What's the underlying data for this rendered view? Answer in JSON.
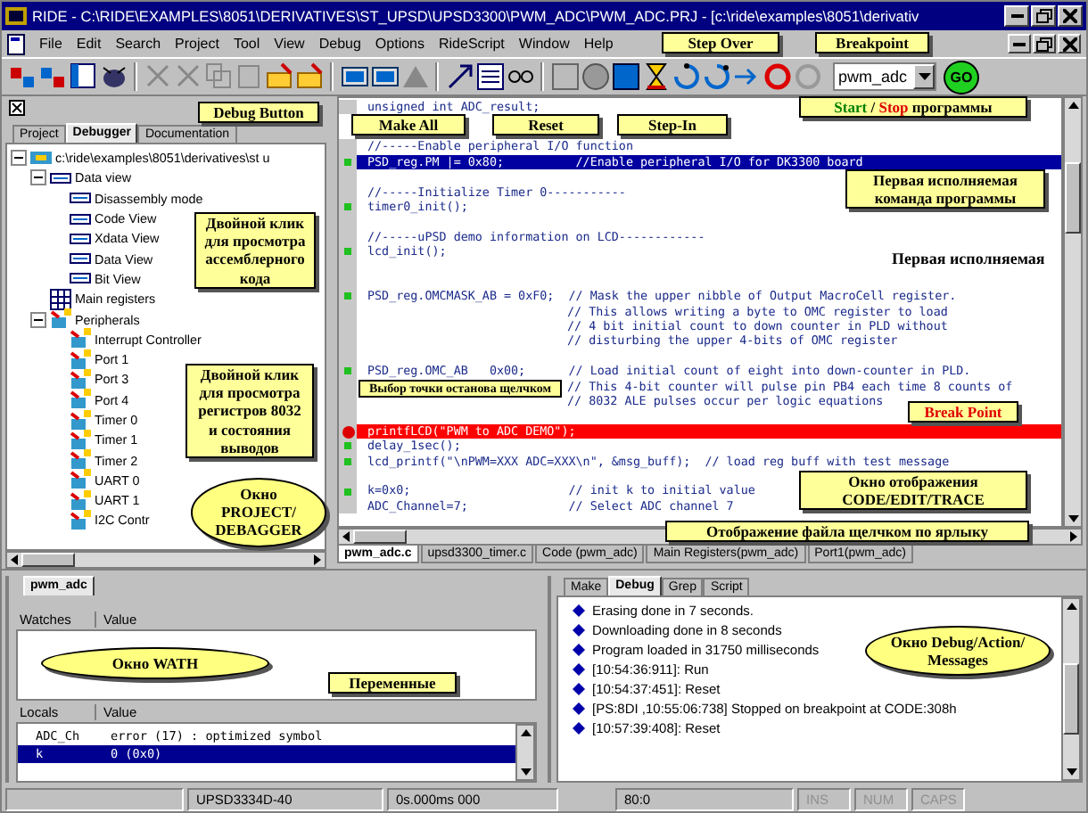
{
  "window": {
    "title": "RIDE - C:\\RIDE\\EXAMPLES\\8051\\DERIVATIVES\\ST_UPSD\\UPSD3300\\PWM_ADC\\PWM_ADC.PRJ - [c:\\ride\\examples\\8051\\derivativ"
  },
  "menu": [
    "File",
    "Edit",
    "Search",
    "Project",
    "Tool",
    "View",
    "Debug",
    "Options",
    "RideScript",
    "Window",
    "Help"
  ],
  "toolbar": {
    "target": "pwm_adc",
    "go_button": "GO"
  },
  "left_panel": {
    "tabs": [
      {
        "label": "Project",
        "selected": false
      },
      {
        "label": "Debugger",
        "selected": true
      },
      {
        "label": "Documentation",
        "selected": false
      }
    ],
    "tree": [
      {
        "label": "c:\\ride\\examples\\8051\\derivatives\\st u",
        "kind": "project",
        "expanded": true,
        "children": [
          {
            "label": "Data view",
            "kind": "view",
            "expanded": true,
            "children": [
              {
                "label": "Disassembly mode",
                "kind": "view"
              },
              {
                "label": "Code View",
                "kind": "view"
              },
              {
                "label": "Xdata View",
                "kind": "view"
              },
              {
                "label": "Data View",
                "kind": "view"
              },
              {
                "label": "Bit View",
                "kind": "view"
              }
            ]
          },
          {
            "label": "Main registers",
            "kind": "registers"
          },
          {
            "label": "Peripherals",
            "kind": "peripheral",
            "expanded": true,
            "children": [
              {
                "label": "Interrupt Controller",
                "kind": "peripheral"
              },
              {
                "label": "Port 1",
                "kind": "peripheral"
              },
              {
                "label": "Port 3",
                "kind": "peripheral"
              },
              {
                "label": "Port 4",
                "kind": "peripheral"
              },
              {
                "label": "Timer 0",
                "kind": "peripheral"
              },
              {
                "label": "Timer 1",
                "kind": "peripheral"
              },
              {
                "label": "Timer 2",
                "kind": "peripheral"
              },
              {
                "label": "UART 0",
                "kind": "peripheral"
              },
              {
                "label": "UART 1",
                "kind": "peripheral"
              },
              {
                "label": "I2C Contr",
                "kind": "peripheral"
              }
            ]
          }
        ]
      }
    ]
  },
  "editor": {
    "lines": [
      {
        "text": "unsigned int ADC_result;",
        "kind": "code",
        "marked": false
      },
      {
        "text": "//-----Enable peripheral I/O function",
        "kind": "code",
        "marked": false
      },
      {
        "text": "PSD_reg.PM |= 0x80;          //Enable peripheral I/O for DK3300 board",
        "kind": "current",
        "marked": true
      },
      {
        "kind": "code",
        "marked": false
      },
      {
        "text": "//-----Initialize Timer 0-----------",
        "kind": "code",
        "marked": false
      },
      {
        "text": "timer0_init();",
        "kind": "code",
        "marked": true
      },
      {
        "kind": "code",
        "marked": false
      },
      {
        "text": "//-----uPSD demo information on LCD------------",
        "kind": "code",
        "marked": false
      },
      {
        "text": "lcd_init();",
        "kind": "code",
        "marked": true
      },
      {
        "kind": "code",
        "marked": false
      },
      {
        "kind": "code",
        "marked": false
      },
      {
        "text": "PSD_reg.OMCMASK_AB = 0xF0;  // Mask the upper nibble of Output MacroCell register.",
        "kind": "code",
        "marked": true
      },
      {
        "text": "// This allows writing a byte to OMC register to load",
        "kind": "comment",
        "marked": false
      },
      {
        "text": "// 4 bit initial count to down counter in PLD without",
        "kind": "comment",
        "marked": false
      },
      {
        "text": "// disturbing the upper 4-bits of OMC register",
        "kind": "comment",
        "marked": false
      },
      {
        "kind": "code",
        "marked": false
      },
      {
        "text": "PSD_reg.OMC_AB   0x00;      // Load initial count of eight into down-counter in PLD.",
        "kind": "code",
        "marked": true
      },
      {
        "text": "// This 4-bit counter will pulse pin PB4 each time 8 counts of",
        "kind": "comment",
        "marked": false
      },
      {
        "text": "// 8032 ALE pulses occur per logic equations",
        "kind": "comment",
        "marked": false
      },
      {
        "kind": "code",
        "marked": false
      },
      {
        "text": "printfLCD(\"PWM to ADC DEMO\");",
        "kind": "breakpoint",
        "marked": false
      },
      {
        "text": "delay_1sec();",
        "kind": "code",
        "marked": true
      },
      {
        "text": "lcd_printf(\"\\nPWM=XXX ADC=XXX\\n\", &msg_buff);  // load reg buff with test message",
        "kind": "code",
        "marked": true
      },
      {
        "kind": "code",
        "marked": false
      },
      {
        "text": "k=0x0;                      // init k to initial value",
        "kind": "code",
        "marked": true
      },
      {
        "text": "ADC_Channel=7;              // Select ADC channel 7",
        "kind": "code",
        "marked": false
      }
    ]
  },
  "file_tabs": [
    {
      "label": "pwm_adc.c",
      "selected": true
    },
    {
      "label": "upsd3300_timer.c",
      "selected": false
    },
    {
      "label": "Code (pwm_adc)",
      "selected": false
    },
    {
      "label": "Main Registers(pwm_adc)",
      "selected": false
    },
    {
      "label": "Port1(pwm_adc)",
      "selected": false
    }
  ],
  "watch_panel": {
    "tab": "pwm_adc",
    "watches_header": [
      "Watches",
      "Value"
    ],
    "locals_header": [
      "Locals",
      "Value"
    ],
    "locals": [
      {
        "name": "ADC_Ch",
        "value": "error (17) : optimized symbol",
        "selected": false
      },
      {
        "name": "k",
        "value": "0 (0x0)",
        "selected": true
      }
    ]
  },
  "messages_panel": {
    "tabs": [
      {
        "label": "Make",
        "selected": false
      },
      {
        "label": "Debug",
        "selected": true
      },
      {
        "label": "Grep",
        "selected": false
      },
      {
        "label": "Script",
        "selected": false
      }
    ],
    "lines": [
      "Erasing done in 7 seconds.",
      "Downloading done in 8 seconds",
      "Program loaded in 31750 milliseconds",
      "[10:54:36:911]:   Run",
      "[10:54:37:451]:   Reset",
      "[PS:8DI ,10:55:06:738]    Stopped on breakpoint at CODE:308h",
      "[10:57:39:408]:   Reset"
    ]
  },
  "status_bar": [
    "UPSD3334D-40",
    "0s.000ms 000",
    "80:0",
    "INS",
    "NUM",
    "CAPS"
  ],
  "callouts": [
    {
      "kind": "label",
      "parts": [
        {
          "text": "Step Over",
          "kind": "normal"
        }
      ]
    },
    {
      "kind": "label",
      "parts": [
        {
          "text": "Breakpoint",
          "kind": "normal"
        }
      ]
    },
    {
      "kind": "label",
      "parts": [
        {
          "text": "Debug Button",
          "kind": "normal"
        }
      ]
    },
    {
      "kind": "label",
      "parts": [
        {
          "text": "Make All",
          "kind": "normal"
        }
      ]
    },
    {
      "kind": "label",
      "parts": [
        {
          "text": "Reset",
          "kind": "normal"
        }
      ]
    },
    {
      "kind": "label",
      "parts": [
        {
          "text": "Step-In",
          "kind": "normal"
        }
      ]
    },
    {
      "kind": "label",
      "parts": [
        {
          "text": "Start",
          "kind": "go"
        },
        {
          "text": "/",
          "kind": "normal"
        },
        {
          "text": "Stop",
          "kind": "stop"
        },
        {
          "text": "программы",
          "kind": "normal"
        }
      ]
    },
    {
      "kind": "label",
      "parts": [
        {
          "text": "Первая исполняемая команда программы",
          "kind": "normal"
        }
      ]
    },
    {
      "kind": "label",
      "parts": [
        {
          "text": "Двойной клик для просмотра ассемблерного кода",
          "kind": "normal"
        }
      ]
    },
    {
      "kind": "plain",
      "parts": [
        {
          "text": "Первая исполняемая",
          "kind": "normal"
        }
      ]
    },
    {
      "kind": "label",
      "parts": [
        {
          "text": "Двойной клик для просмотра регистров 8032 и состояния выводов",
          "kind": "normal"
        }
      ]
    },
    {
      "kind": "label",
      "parts": [
        {
          "text": "Выбор точки останова щелчком",
          "kind": "normal"
        }
      ]
    },
    {
      "kind": "label",
      "parts": [
        {
          "text": "Break Point",
          "kind": "stop"
        }
      ]
    },
    {
      "kind": "oval",
      "parts": [
        {
          "text": "Окно PROJECT/ DEBAGGER",
          "kind": "normal"
        }
      ]
    },
    {
      "kind": "label",
      "parts": [
        {
          "text": "Окно отображения CODE/EDIT/TRACE",
          "kind": "normal"
        }
      ]
    },
    {
      "kind": "label",
      "parts": [
        {
          "text": "Отображение файла щелчком по ярлыку",
          "kind": "normal"
        }
      ]
    },
    {
      "kind": "oval",
      "parts": [
        {
          "text": "Окно WATH",
          "kind": "normal"
        }
      ]
    },
    {
      "kind": "label",
      "parts": [
        {
          "text": "Переменные",
          "kind": "normal"
        }
      ]
    },
    {
      "kind": "oval",
      "parts": [
        {
          "text": "Окно Debug/Action/ Messages",
          "kind": "normal"
        }
      ]
    }
  ]
}
